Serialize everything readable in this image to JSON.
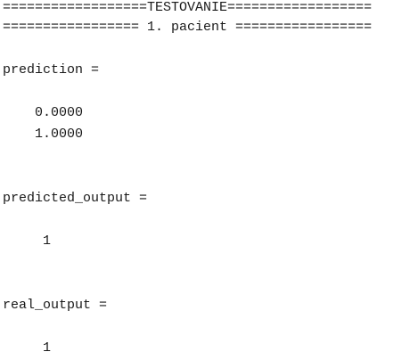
{
  "console": {
    "header_line": "==================TESTOVANIE==================",
    "patient_line": "================= 1. pacient =================",
    "prediction_label": "prediction =",
    "prediction_values": [
      "    0.0000",
      "    1.0000"
    ],
    "predicted_output_label": "predicted_output =",
    "predicted_output_value": "     1",
    "real_output_label": "real_output =",
    "real_output_value": "     1"
  }
}
